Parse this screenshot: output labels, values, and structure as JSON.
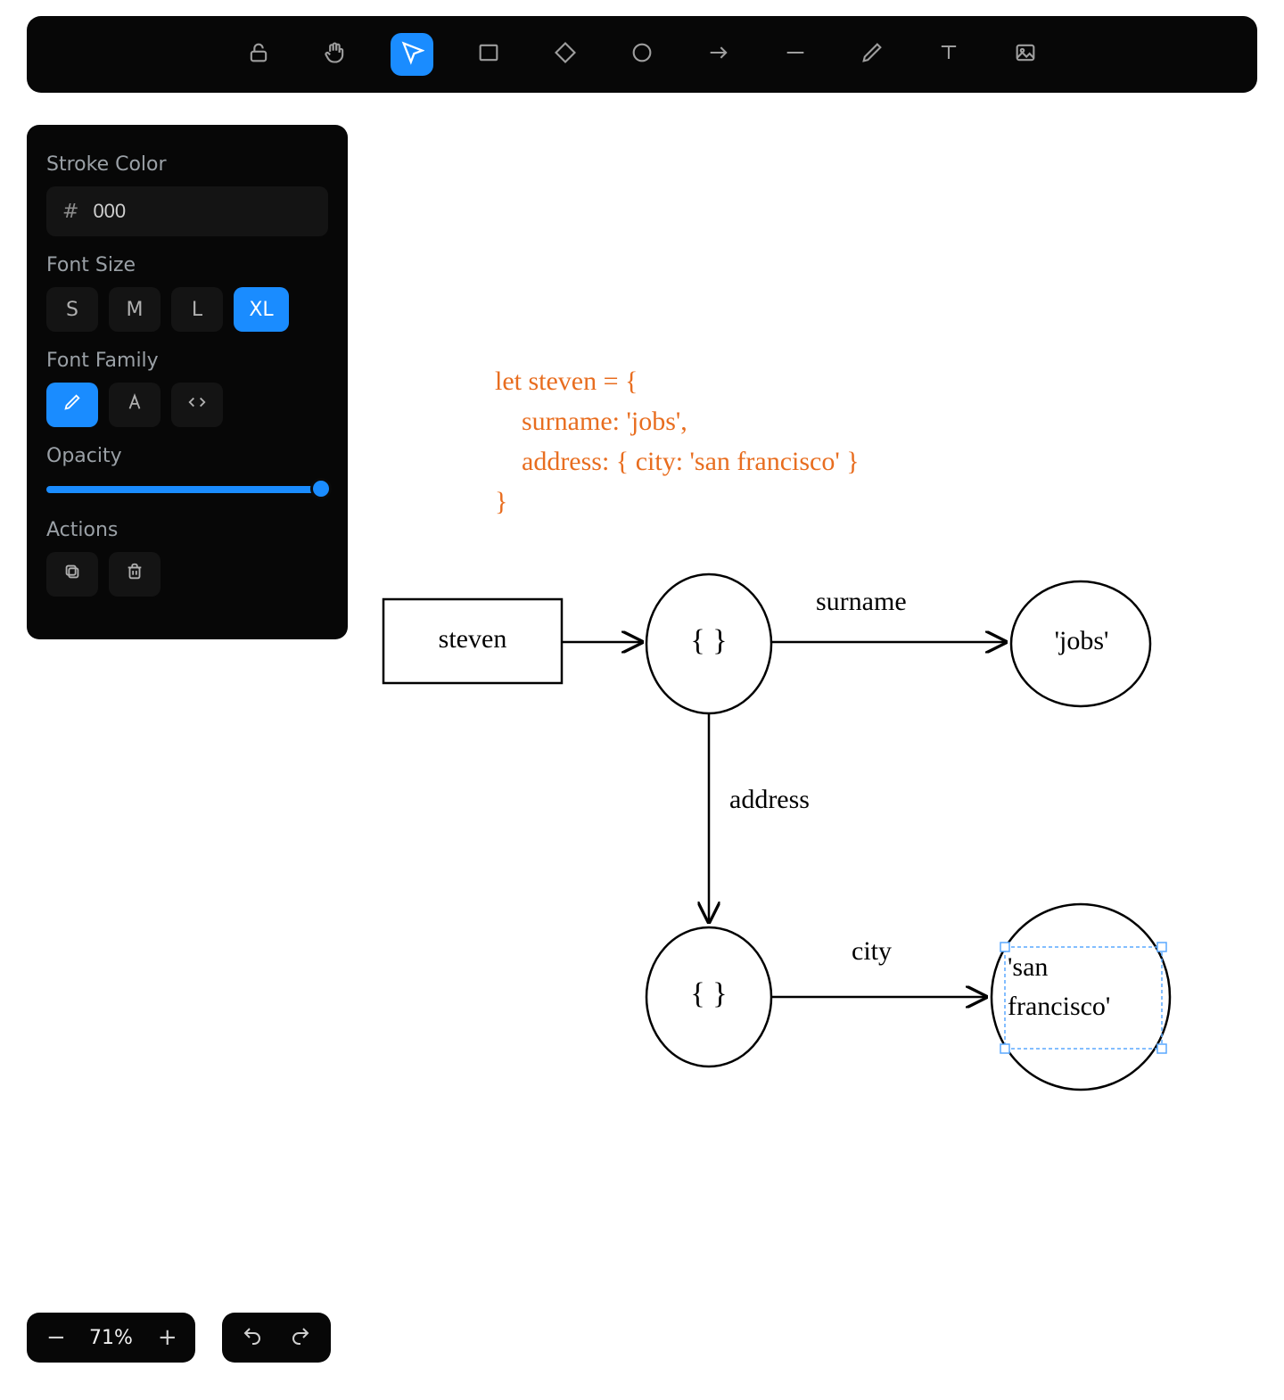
{
  "toolbar": {
    "tools": [
      {
        "name": "lock-icon",
        "active": false
      },
      {
        "name": "pan-icon",
        "active": false
      },
      {
        "name": "select-icon",
        "active": true
      },
      {
        "name": "rectangle-icon",
        "active": false
      },
      {
        "name": "diamond-icon",
        "active": false
      },
      {
        "name": "ellipse-icon",
        "active": false
      },
      {
        "name": "arrow-icon",
        "active": false
      },
      {
        "name": "line-icon",
        "active": false
      },
      {
        "name": "pencil-icon",
        "active": false
      },
      {
        "name": "text-icon",
        "active": false
      },
      {
        "name": "image-icon",
        "active": false
      }
    ]
  },
  "properties": {
    "stroke_color_label": "Stroke Color",
    "hash_symbol": "#",
    "stroke_hex": "000",
    "font_size_label": "Font Size",
    "font_sizes": [
      {
        "label": "S",
        "active": false
      },
      {
        "label": "M",
        "active": false
      },
      {
        "label": "L",
        "active": false
      },
      {
        "label": "XL",
        "active": true
      }
    ],
    "font_family_label": "Font Family",
    "font_families": [
      {
        "name": "hand-drawn-icon",
        "active": true
      },
      {
        "name": "normal-font-icon",
        "active": false
      },
      {
        "name": "code-font-icon",
        "active": false
      }
    ],
    "opacity_label": "Opacity",
    "opacity": 100,
    "actions_label": "Actions",
    "actions": [
      {
        "name": "duplicate-icon"
      },
      {
        "name": "delete-icon"
      }
    ]
  },
  "zoom": {
    "minus": "−",
    "value": "71%",
    "plus": "+"
  },
  "diagram": {
    "code_text": "let steven = {\n    surname: 'jobs',\n    address: { city: 'san francisco' }\n}",
    "nodes": {
      "steven": "steven",
      "obj1": "{ }",
      "jobs": "'jobs'",
      "obj2": "{ }",
      "sanfran_line1": "'san",
      "sanfran_line2": "francisco'"
    },
    "edges": {
      "surname": "surname",
      "address": "address",
      "city": "city"
    }
  },
  "colors": {
    "accent": "#1a8cff",
    "code": "#e86d1f",
    "selection": "#5aa9ff"
  }
}
